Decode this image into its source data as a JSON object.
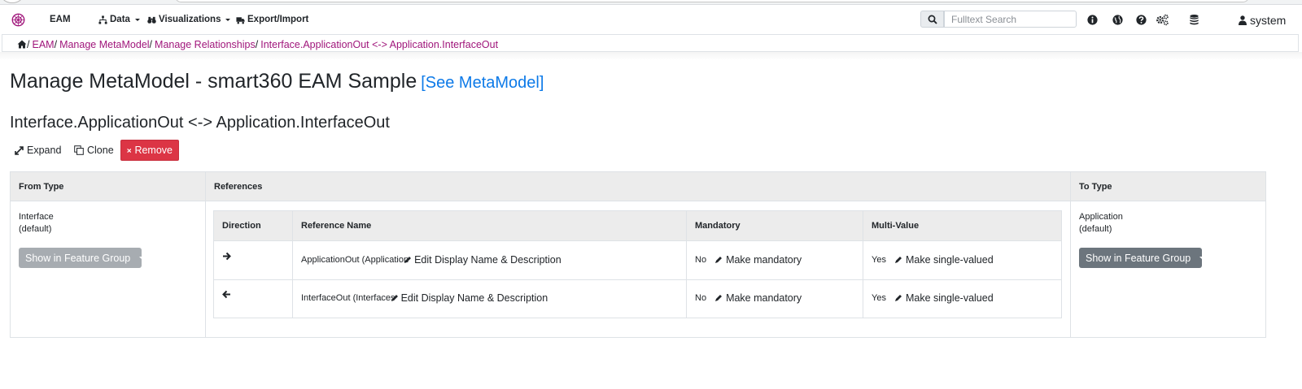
{
  "app": {
    "brand": "EAM"
  },
  "nav": {
    "data": "Data",
    "visualizations": "Visualizations",
    "export_import": "Export/Import",
    "search_placeholder": "Fulltext Search",
    "user": "system"
  },
  "breadcrumb": {
    "items": [
      "EAM",
      "Manage MetaModel",
      "Manage Relationships",
      "Interface.ApplicationOut <-> Application.InterfaceOut"
    ]
  },
  "page": {
    "title": "Manage MetaModel - smart360 EAM Sample",
    "see_link": "[See MetaModel]",
    "relationship_title": "Interface.ApplicationOut <-> Application.InterfaceOut"
  },
  "actions": {
    "expand": "Expand",
    "clone": "Clone",
    "remove": "Remove"
  },
  "table": {
    "headers": {
      "from_type": "From Type",
      "references": "References",
      "to_type": "To Type"
    },
    "from": {
      "type": "Interface",
      "variant": "(default)",
      "feature_button": "Show in Feature Group"
    },
    "to": {
      "type": "Application",
      "variant": "(default)",
      "feature_button": "Show in Feature Group"
    },
    "ref_headers": {
      "direction": "Direction",
      "name": "Reference Name",
      "mandatory": "Mandatory",
      "multi": "Multi-Value"
    },
    "rows": [
      {
        "direction": "right",
        "name": "ApplicationOut (Application",
        "edit": "Edit Display Name & Description",
        "mandatory": "No",
        "mandatory_action": "Make mandatory",
        "multi": "Yes",
        "multi_action": "Make single-valued"
      },
      {
        "direction": "left",
        "name": "InterfaceOut (Interfaces",
        "edit": "Edit Display Name & Description",
        "mandatory": "No",
        "mandatory_action": "Make mandatory",
        "multi": "Yes",
        "multi_action": "Make single-valued"
      }
    ]
  },
  "colors": {
    "link": "#a0167b",
    "see_link": "#0d7ae8",
    "danger": "#dc3545",
    "secondary": "#6c757d"
  }
}
